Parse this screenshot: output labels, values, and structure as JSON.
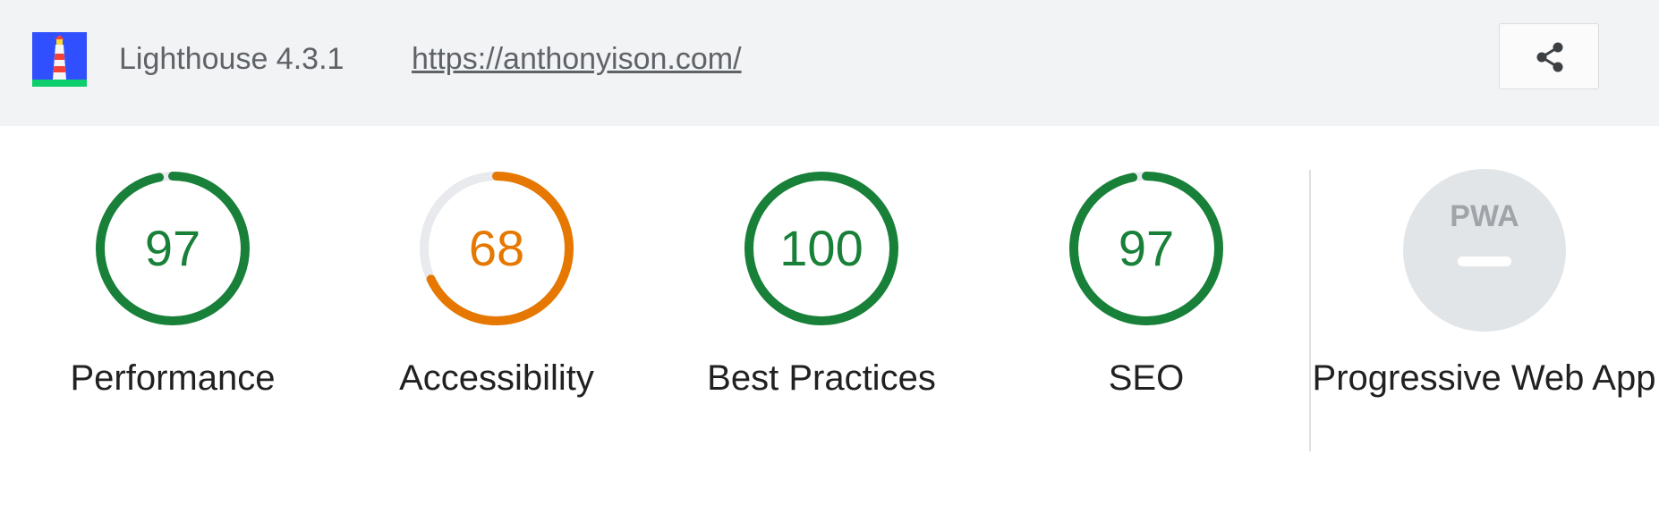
{
  "header": {
    "app_name": "Lighthouse 4.3.1",
    "url": "https://anthonyison.com/",
    "logo_icon": "lighthouse-logo-icon",
    "share_icon": "share-icon"
  },
  "colors": {
    "pass": "#188038",
    "average": "#e67700",
    "track": "#e8eaed",
    "header_bg": "#f1f3f4",
    "pwa_badge": "#e2e5e7"
  },
  "categories": [
    {
      "id": "performance",
      "label": "Performance",
      "score": "97",
      "value": 97,
      "color": "#188038"
    },
    {
      "id": "accessibility",
      "label": "Accessibility",
      "score": "68",
      "value": 68,
      "color": "#e67700"
    },
    {
      "id": "best-practices",
      "label": "Best Practices",
      "score": "100",
      "value": 100,
      "color": "#188038"
    },
    {
      "id": "seo",
      "label": "SEO",
      "score": "97",
      "value": 97,
      "color": "#188038"
    }
  ],
  "pwa": {
    "label": "Progressive Web App",
    "badge_text": "PWA",
    "status": "–"
  }
}
